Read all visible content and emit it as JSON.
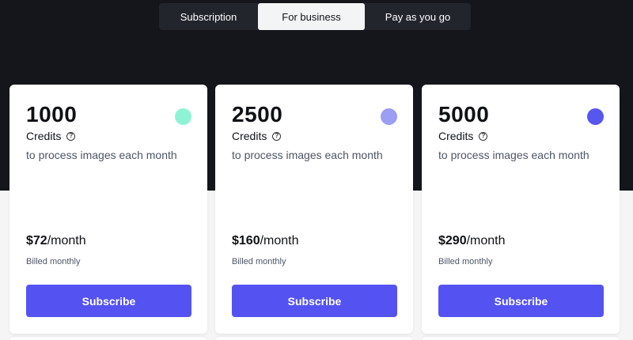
{
  "tabs": [
    {
      "label": "Subscription",
      "active": false
    },
    {
      "label": "For business",
      "active": true
    },
    {
      "label": "Pay as you go",
      "active": false
    }
  ],
  "plans": [
    {
      "credits": "1000",
      "credits_label": "Credits",
      "description": "to process images each month",
      "price": "$72",
      "period": "/month",
      "billing": "Billed monthly",
      "button": "Subscribe",
      "dot_color": "#8ef3d2"
    },
    {
      "credits": "2500",
      "credits_label": "Credits",
      "description": "to process images each month",
      "price": "$160",
      "period": "/month",
      "billing": "Billed monthly",
      "button": "Subscribe",
      "dot_color": "#9c9df3"
    },
    {
      "credits": "5000",
      "credits_label": "Credits",
      "description": "to process images each month",
      "price": "$290",
      "period": "/month",
      "billing": "Billed monthly",
      "button": "Subscribe",
      "dot_color": "#5756ef"
    }
  ],
  "colors": {
    "background_dark": "#14161c",
    "accent": "#5452f0"
  },
  "icons": {
    "help": "question-circle-icon"
  }
}
